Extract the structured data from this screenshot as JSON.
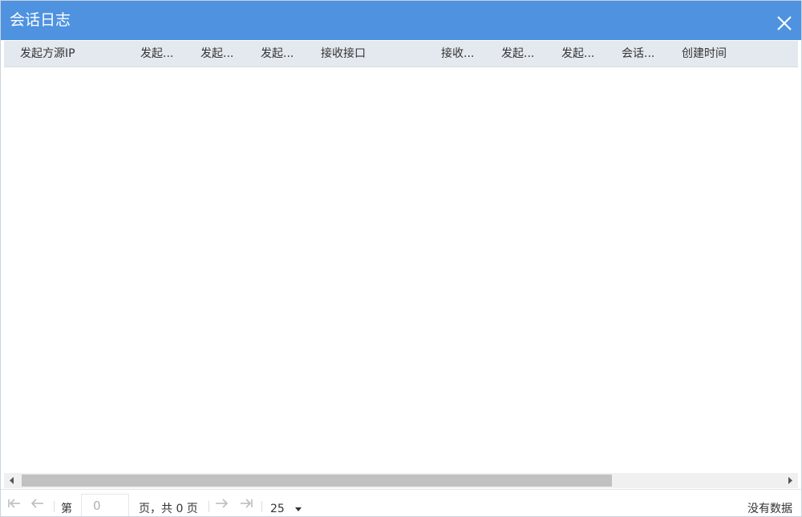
{
  "window": {
    "title": "会话日志"
  },
  "table": {
    "columns": [
      {
        "label": "发起方源IP"
      },
      {
        "label": "发起..."
      },
      {
        "label": "发起..."
      },
      {
        "label": "发起..."
      },
      {
        "label": "接收接口"
      },
      {
        "label": "接收..."
      },
      {
        "label": "发起..."
      },
      {
        "label": "发起..."
      },
      {
        "label": "会话..."
      },
      {
        "label": "创建时间"
      }
    ],
    "rows": []
  },
  "pager": {
    "page_prefix": "第",
    "page_value": "0",
    "page_suffix": "页，共 0 页",
    "page_size": "25",
    "status": "没有数据"
  },
  "colors": {
    "titlebar": "#4f93e0",
    "header_bg": "#e4e9ef",
    "scrollbar_thumb": "#c1c1c1"
  },
  "icons": {
    "close": "close-icon",
    "first_page": "first-page-icon",
    "prev_page": "prev-page-icon",
    "next_page": "next-page-icon",
    "last_page": "last-page-icon",
    "dropdown": "caret-down-icon",
    "scroll_left": "scroll-left-arrow-icon",
    "scroll_right": "scroll-right-arrow-icon"
  }
}
